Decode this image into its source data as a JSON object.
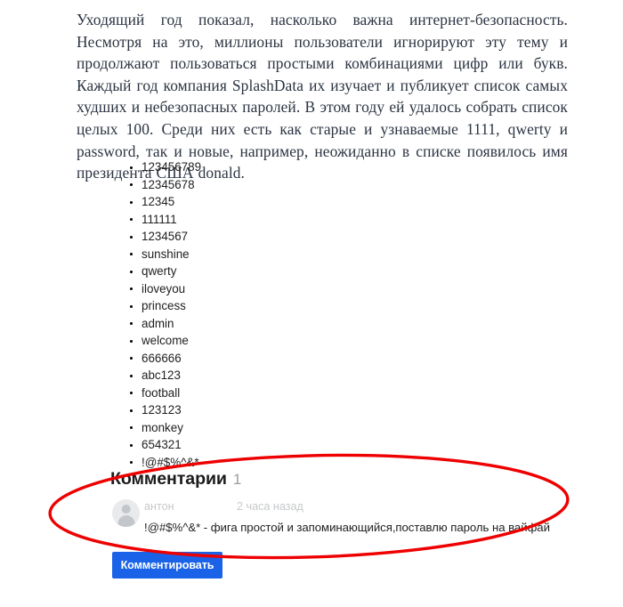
{
  "article": {
    "paragraph": "Уходящий год показал, насколько важна интернет-безопасность. Несмотря на это, миллионы пользователи игнорируют эту тему и продолжают пользоваться простыми комбинациями цифр или букв. Каждый год компания SplashData их изучает и публикует список самых худших и небезопасных паролей. В этом году ей удалось собрать список целых 100. Среди них есть как старые и узнаваемые 1111, qwerty и password, так и новые, например, неожиданно в списке появилось имя президента США donald.",
    "password_list": [
      "123456789",
      "12345678",
      "12345",
      "111111",
      "1234567",
      "sunshine",
      "qwerty",
      "iloveyou",
      "princess",
      "admin",
      "welcome",
      "666666",
      "abc123",
      "football",
      "123123",
      "monkey",
      "654321",
      "!@#$%^&*"
    ]
  },
  "comments": {
    "heading": "Комментарии",
    "count": "1",
    "items": [
      {
        "author": "антон",
        "time": "2 часа назад",
        "text": "!@#$%^&* - фига простой и запоминающийся,поставлю пароль на вайфай",
        "avatar_icon": "user-avatar-placeholder-icon"
      }
    ],
    "submit_label": "Комментировать"
  },
  "annotation": {
    "shape": "ellipse",
    "color": "#ee0000",
    "stroke_width": 3.4
  },
  "colors": {
    "accent_blue": "#1a63e8",
    "annotation_red": "#ee0000",
    "body_text": "#2c3442",
    "muted_gray": "#c6c8ca"
  }
}
